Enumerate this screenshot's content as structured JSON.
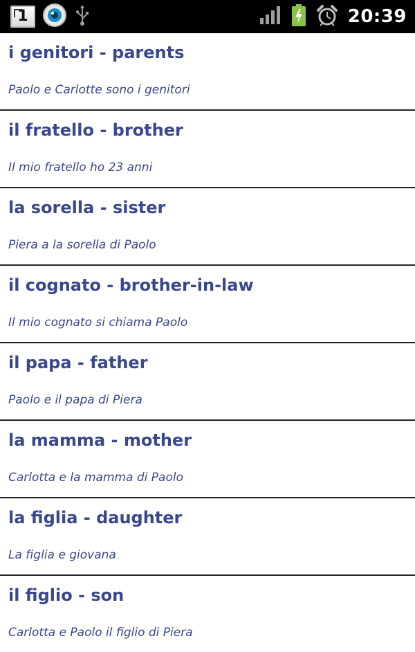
{
  "status_bar": {
    "notification_count": "1",
    "time": "20:39",
    "icons": [
      "notification-count-icon",
      "camera-lens-icon",
      "usb-icon",
      "signal-icon",
      "battery-charging-icon",
      "alarm-icon"
    ]
  },
  "vocab": {
    "items": [
      {
        "title": "i genitori - parents",
        "example": "Paolo e Carlotte sono i genitori"
      },
      {
        "title": "il fratello - brother",
        "example": "Il mio fratello ho 23 anni"
      },
      {
        "title": "la sorella - sister",
        "example": "Piera a la sorella di Paolo"
      },
      {
        "title": "il cognato - brother-in-law",
        "example": "Il mio cognato si chiama Paolo"
      },
      {
        "title": "il papa - father",
        "example": "Paolo e il papa di Piera"
      },
      {
        "title": "la mamma - mother",
        "example": "Carlotta e la mamma di Paolo"
      },
      {
        "title": "la figlia - daughter",
        "example": "La figlia e giovana"
      },
      {
        "title": "il figlio - son",
        "example": "Carlotta e Paolo il figlio di Piera"
      }
    ]
  },
  "colors": {
    "text_accent": "#3a478c",
    "status_bar_bg": "#000000",
    "battery_green": "#8bc34a"
  }
}
